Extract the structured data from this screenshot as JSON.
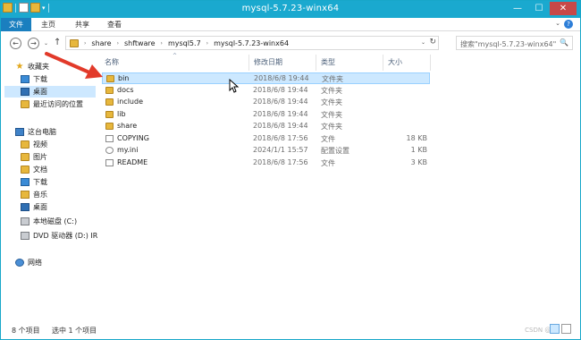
{
  "window": {
    "title": "mysql-5.7.23-winx64",
    "controls": {
      "minimize": "—",
      "maximize": "☐",
      "close": "✕"
    }
  },
  "quick_access_toolbar": {
    "dropdown": "▾"
  },
  "ribbon": {
    "tabs": [
      {
        "label": "文件"
      },
      {
        "label": "主页"
      },
      {
        "label": "共享"
      },
      {
        "label": "查看"
      }
    ],
    "help": "?",
    "collapse": "⌄"
  },
  "address_bar": {
    "back": "←",
    "forward": "→",
    "history": "⌄",
    "up": "↑",
    "breadcrumb": [
      "share",
      "shftware",
      "mysql5.7",
      "mysql-5.7.23-winx64"
    ],
    "separator": "›",
    "dropdown": "⌄",
    "refresh": "↻"
  },
  "search": {
    "placeholder": "搜索\"mysql-5.7.23-winx64\"",
    "icon": "🔍"
  },
  "nav_pane": {
    "favorites": {
      "label": "收藏夹",
      "items": [
        {
          "label": "下载"
        },
        {
          "label": "桌面"
        },
        {
          "label": "最近访问的位置"
        }
      ]
    },
    "this_pc": {
      "label": "这台电脑",
      "items": [
        {
          "label": "视频"
        },
        {
          "label": "图片"
        },
        {
          "label": "文档"
        },
        {
          "label": "下载"
        },
        {
          "label": "音乐"
        },
        {
          "label": "桌面"
        },
        {
          "label": "本地磁盘 (C:)"
        },
        {
          "label": "DVD 驱动器 (D:) IR"
        }
      ]
    },
    "network": {
      "label": "网络"
    }
  },
  "file_list": {
    "columns": {
      "name": "名称",
      "date": "修改日期",
      "type": "类型",
      "size": "大小"
    },
    "sort_indicator": "^",
    "rows": [
      {
        "name": "bin",
        "date": "2018/6/8 19:44",
        "type": "文件夹",
        "size": "",
        "kind": "folder"
      },
      {
        "name": "docs",
        "date": "2018/6/8 19:44",
        "type": "文件夹",
        "size": "",
        "kind": "folder"
      },
      {
        "name": "include",
        "date": "2018/6/8 19:44",
        "type": "文件夹",
        "size": "",
        "kind": "folder"
      },
      {
        "name": "lib",
        "date": "2018/6/8 19:44",
        "type": "文件夹",
        "size": "",
        "kind": "folder"
      },
      {
        "name": "share",
        "date": "2018/6/8 19:44",
        "type": "文件夹",
        "size": "",
        "kind": "folder"
      },
      {
        "name": "COPYING",
        "date": "2018/6/8 17:56",
        "type": "文件",
        "size": "18 KB",
        "kind": "file"
      },
      {
        "name": "my.ini",
        "date": "2024/1/1 15:57",
        "type": "配置设置",
        "size": "1 KB",
        "kind": "ini"
      },
      {
        "name": "README",
        "date": "2018/6/8 17:56",
        "type": "文件",
        "size": "3 KB",
        "kind": "file"
      }
    ],
    "selected_row": "bin"
  },
  "status_bar": {
    "item_count": "8 个项目",
    "selection": "选中 1 个项目"
  },
  "watermark": "CSDN @...",
  "colors": {
    "titlebar": "#1aa9cf",
    "file_tab": "#1a7fbf",
    "close_button": "#c74848",
    "selection": "#cce8ff",
    "annotation_arrow": "#e23a2a"
  }
}
